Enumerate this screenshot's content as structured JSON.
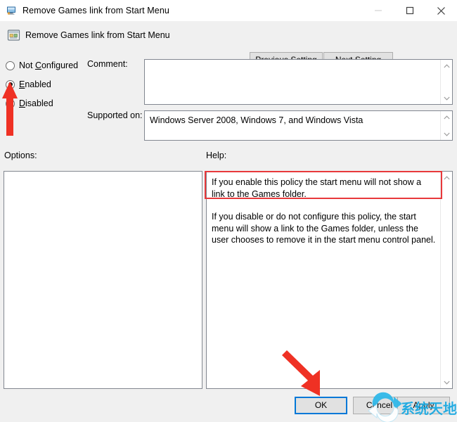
{
  "window": {
    "title": "Remove Games link from Start Menu",
    "title_icon": "computer-monitor-icon",
    "caption": {
      "minimize": "minimize-icon",
      "maximize": "maximize-icon",
      "close": "close-icon"
    }
  },
  "header": {
    "title": "Remove Games link from Start Menu",
    "icon": "policy-setting-icon",
    "previous_setting": "Previous Setting",
    "next_setting": "Next Setting"
  },
  "state_options": [
    {
      "id": "not-configured",
      "label": "Not Configured",
      "accel": "C",
      "checked": false
    },
    {
      "id": "enabled",
      "label": "Enabled",
      "accel": "E",
      "checked": true
    },
    {
      "id": "disabled",
      "label": "Disabled",
      "accel": "D",
      "checked": false
    }
  ],
  "fields": {
    "comment_label": "Comment:",
    "comment_value": "",
    "supported_label": "Supported on:",
    "supported_value": "Windows Server 2008, Windows 7, and Windows Vista"
  },
  "panels": {
    "options_label": "Options:",
    "options_value": "",
    "help_label": "Help:",
    "help_paragraphs": [
      "If you enable this policy the start menu will not show a link to the Games folder.",
      "If you disable or do not configure this policy, the start menu will show a link to the Games folder, unless the user chooses to remove it in the start menu control panel."
    ]
  },
  "buttons": {
    "ok": "OK",
    "cancel": "Cancel",
    "apply": "Apply"
  },
  "watermark": {
    "text": "系统天地",
    "icon": "refresh-circular-arrow-icon",
    "color": "#16a7e0"
  },
  "annotations": {
    "highlight_color": "#e8393b",
    "arrow_to_enabled": "red-arrow-up",
    "arrow_to_ok": "red-arrow-down-right",
    "highlight_help_first_paragraph": true,
    "focus_color": "#0078d7"
  }
}
